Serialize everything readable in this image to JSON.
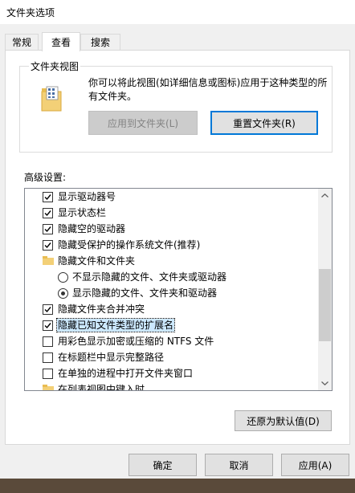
{
  "window": {
    "title": "文件夹选项"
  },
  "tabs": [
    {
      "label": "常规",
      "active": false
    },
    {
      "label": "查看",
      "active": true
    },
    {
      "label": "搜索",
      "active": false
    }
  ],
  "folder_views": {
    "title": "文件夹视图",
    "description": "你可以将此视图(如详细信息或图标)应用于这种类型的所有文件夹。",
    "apply_button": "应用到文件夹(L)",
    "reset_button": "重置文件夹(R)"
  },
  "advanced": {
    "label": "高级设置:",
    "items": [
      {
        "type": "checkbox",
        "checked": true,
        "label": "显示驱动器号"
      },
      {
        "type": "checkbox",
        "checked": true,
        "label": "显示状态栏"
      },
      {
        "type": "checkbox",
        "checked": true,
        "label": "隐藏空的驱动器"
      },
      {
        "type": "checkbox",
        "checked": true,
        "label": "隐藏受保护的操作系统文件(推荐)"
      },
      {
        "type": "folder",
        "label": "隐藏文件和文件夹"
      },
      {
        "type": "radio",
        "checked": false,
        "label": "不显示隐藏的文件、文件夹或驱动器"
      },
      {
        "type": "radio",
        "checked": true,
        "label": "显示隐藏的文件、文件夹和驱动器"
      },
      {
        "type": "checkbox",
        "checked": true,
        "label": "隐藏文件夹合并冲突"
      },
      {
        "type": "checkbox",
        "checked": true,
        "label": "隐藏已知文件类型的扩展名",
        "selected": true
      },
      {
        "type": "checkbox",
        "checked": false,
        "label": "用彩色显示加密或压缩的 NTFS 文件"
      },
      {
        "type": "checkbox",
        "checked": false,
        "label": "在标题栏中显示完整路径"
      },
      {
        "type": "checkbox",
        "checked": false,
        "label": "在单独的进程中打开文件夹窗口"
      },
      {
        "type": "folder",
        "label": "在列表视图中键入时"
      }
    ]
  },
  "restore_button": "还原为默认值(D)",
  "dialog": {
    "ok": "确定",
    "cancel": "取消",
    "apply": "应用(A)"
  }
}
